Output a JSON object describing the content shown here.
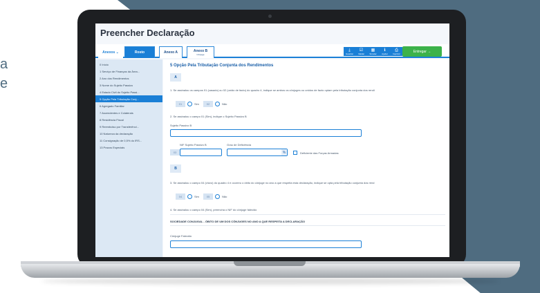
{
  "side_text": [
    "a",
    "e"
  ],
  "app": {
    "title": "Preencher Declaração",
    "tabs": [
      {
        "label": "Anexos ⌄"
      },
      {
        "label": "Rosto"
      },
      {
        "label": "Anexo A"
      },
      {
        "label": "Anexo B",
        "sub": "Cônjuge"
      }
    ],
    "tools": [
      {
        "icon": "download-icon",
        "glyph": "⤓",
        "label": "Guardar"
      },
      {
        "icon": "check-icon",
        "glyph": "☑",
        "label": "Validar"
      },
      {
        "icon": "calculator-icon",
        "glyph": "▦",
        "label": "Simular"
      },
      {
        "icon": "info-icon",
        "glyph": "ℹ",
        "label": "Ajudar"
      },
      {
        "icon": "print-icon",
        "glyph": "⎙",
        "label": "Imprimir"
      }
    ],
    "submit": "Entregar →"
  },
  "sidebar": {
    "items": [
      {
        "label": "0  Início"
      },
      {
        "label": "1  Serviço de Finanças da Área..."
      },
      {
        "label": "2  Ano dos Rendimentos"
      },
      {
        "label": "3  Nome do Sujeito Passivo"
      },
      {
        "label": "4  Estado Civil do Sujeito Passi..."
      },
      {
        "label": "5  Opção Pela Tributação Conj..."
      },
      {
        "label": "6  Agregado Familiar"
      },
      {
        "label": "7  Ascendentes e Colaterais"
      },
      {
        "label": "8  Residência Fiscal"
      },
      {
        "label": "9  Reembolso por Transferênci..."
      },
      {
        "label": "10  Natureza da declaração"
      },
      {
        "label": "11  Consignação de 0,5% do IRS..."
      },
      {
        "label": "13  Prazos Especiais"
      }
    ],
    "active_index": 5
  },
  "main": {
    "section_title": "5  Opção Pela Tributação Conjunta dos Rendimentos",
    "part_a": "A",
    "q1": "1. Se assinalou os campos 01 (casado) ou 02 (unido de facto) do quadro 4, indique se ambos os cônjuges ou unidos de facto optam pela tributação conjunta dos rendi",
    "code_01": "01",
    "sim_label": "Sim",
    "code_02": "02",
    "nao_label": "Não",
    "q2": "2. Se assinalou o campo 01 (Sim), indique o Sujeito Passivo B",
    "sp_b_label": "Sujeito Passivo B",
    "nif_label": "NIF Sujeito Passivo B",
    "deficiencia_label": "Grau de Deficiência",
    "code_03": "03",
    "percent": "%",
    "forcas_label": "Deficiente das Forças Armadas",
    "part_b": "B",
    "q3": "3. Se assinalou o campo 04 (viúvo) do quadro 4 e ocorreu o óbito do cônjuge no ano a que respeita esta declaração, indique se opta pela tributação conjunta dos rend",
    "code_04": "04",
    "sim2_label": "Sim",
    "code_05": "05",
    "nao2_label": "Não",
    "q4": "4. Se assinalou o campo 04 (Sim), preencha o NIF do cônjuge falecido",
    "sociedade": "SOCIEDADE CONJUGAL - ÓBITO DE UM DOS CÔNJUGES NO ANO A QUE RESPEITA A DECLARAÇÃO",
    "conjuge_label": "Cônjuge Falecido"
  }
}
